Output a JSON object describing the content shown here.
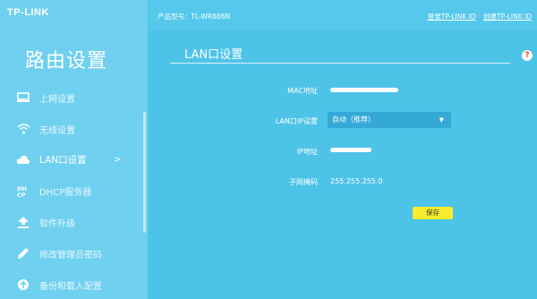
{
  "header": {
    "logo": "TP-LINK",
    "model": "产品型号：TL-WR886N",
    "login_link": "登录TP-LINK ID",
    "create_link": "创建TP-LINK ID"
  },
  "sidebar": {
    "title": "路由设置",
    "items": [
      {
        "label": "上网设置",
        "icon": "monitor-icon"
      },
      {
        "label": "无线设置",
        "icon": "wifi-icon"
      },
      {
        "label": "LAN口设置",
        "icon": "cloud-icon",
        "active": true,
        "chevron": ">"
      },
      {
        "label": "DHCP服务器",
        "icon": "dhcp-icon"
      },
      {
        "label": "软件升级",
        "icon": "upload-icon"
      },
      {
        "label": "修改管理员密码",
        "icon": "pencil-icon"
      },
      {
        "label": "备份和载入配置",
        "icon": "backup-icon"
      }
    ]
  },
  "main": {
    "title": "LAN口设置",
    "help": "?",
    "fields": {
      "mac_label": "MAC地址",
      "lan_ip_label": "LAN口IP设置",
      "lan_ip_value": "自动（推荐）",
      "ip_label": "IP地址",
      "mask_label": "子网掩码",
      "mask_value": "255.255.255.0"
    },
    "save": "保存"
  },
  "colors": {
    "background": "#4ec3e8",
    "sidebar": "#6fd0f0",
    "select": "#34a9d8",
    "save_button": "#f7ec2e"
  }
}
